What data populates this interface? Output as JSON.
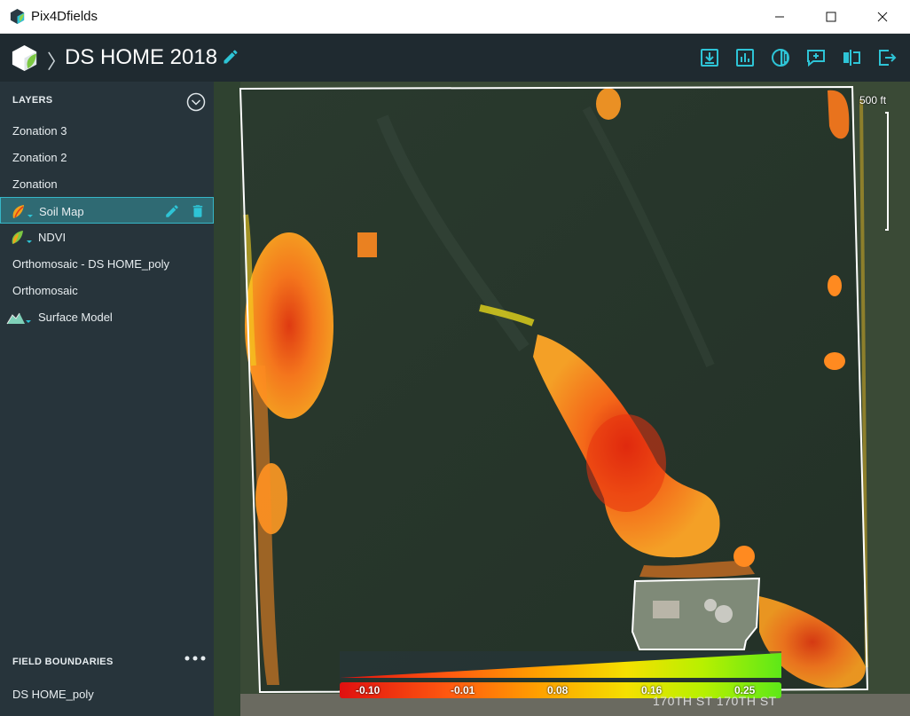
{
  "window": {
    "title": "Pix4Dfields"
  },
  "header": {
    "project_title": "DS HOME 2018"
  },
  "toolbar": {
    "icons": [
      "download-icon",
      "chart-icon",
      "contrast-icon",
      "annotate-icon",
      "compare-icon",
      "exit-icon"
    ]
  },
  "sidebar": {
    "layers_title": "LAYERS",
    "layers": [
      {
        "label": "Zonation 3"
      },
      {
        "label": "Zonation 2"
      },
      {
        "label": "Zonation"
      },
      {
        "label": "Soil Map",
        "selected": true
      },
      {
        "label": "NDVI"
      },
      {
        "label": "Orthomosaic - DS HOME_poly"
      },
      {
        "label": "Orthomosaic"
      },
      {
        "label": "Surface Model"
      }
    ],
    "field_boundaries_title": "FIELD BOUNDARIES",
    "field_boundaries": [
      {
        "label": "DS HOME_poly"
      }
    ]
  },
  "map": {
    "scale_label": "500 ft",
    "road_label": "170TH ST 170TH ST",
    "legend_ticks": [
      "-0.10",
      "-0.01",
      "0.08",
      "0.16",
      "0.25"
    ]
  },
  "colors": {
    "accent": "#2ec4d6",
    "header_bg": "#1f2a30",
    "sidebar_bg": "#27343b",
    "selected_bg": "#2f6a73"
  }
}
